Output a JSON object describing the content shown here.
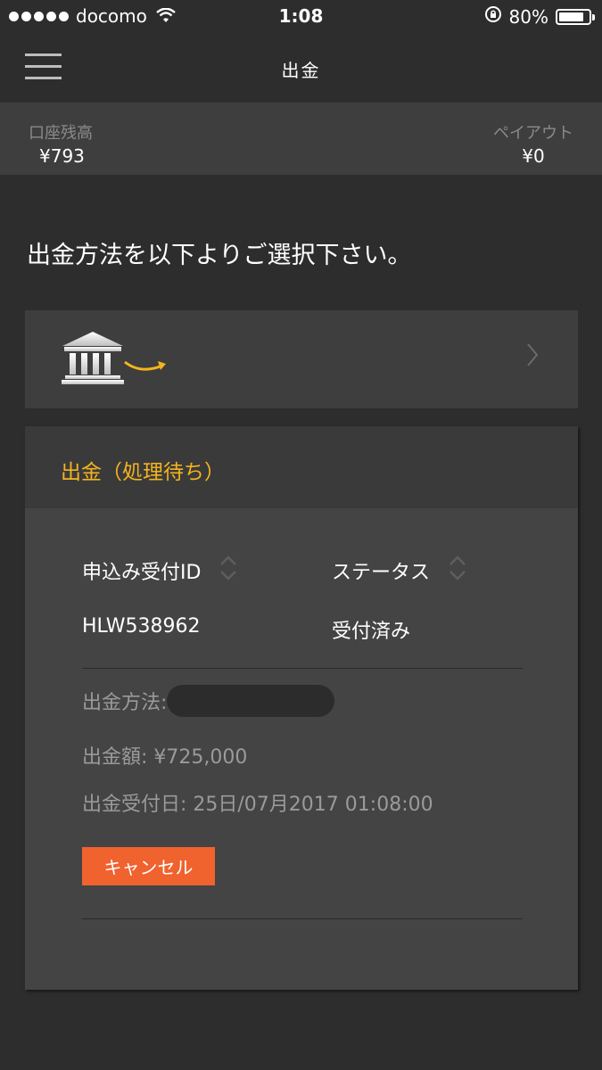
{
  "status_bar": {
    "carrier": "docomo",
    "time": "1:08",
    "battery": "80%",
    "battery_level": 0.8
  },
  "header": {
    "title": "出金"
  },
  "balance": {
    "account_label": "口座残高",
    "account_value": "¥793",
    "payout_label": "ペイアウト",
    "payout_value": "¥0"
  },
  "instruction": "出金方法を以下よりご選択下さい。",
  "method": {
    "icon": "bank-icon",
    "accent_color": "#f5b41f"
  },
  "pending": {
    "title": "出金（処理待ち）",
    "columns": [
      "申込み受付ID",
      "ステータス"
    ],
    "row": {
      "id": "HLW538962",
      "status": "受付済み"
    },
    "method_label": "出金方法:",
    "amount_label": "出金額: ¥725,000",
    "date_label": "出金受付日: 25日/07月2017 01:08:00",
    "cancel_label": "キャンセル"
  },
  "colors": {
    "background": "#2d2d2d",
    "panel": "#444444",
    "accent": "#f5b41f",
    "cancel": "#f0622e"
  }
}
